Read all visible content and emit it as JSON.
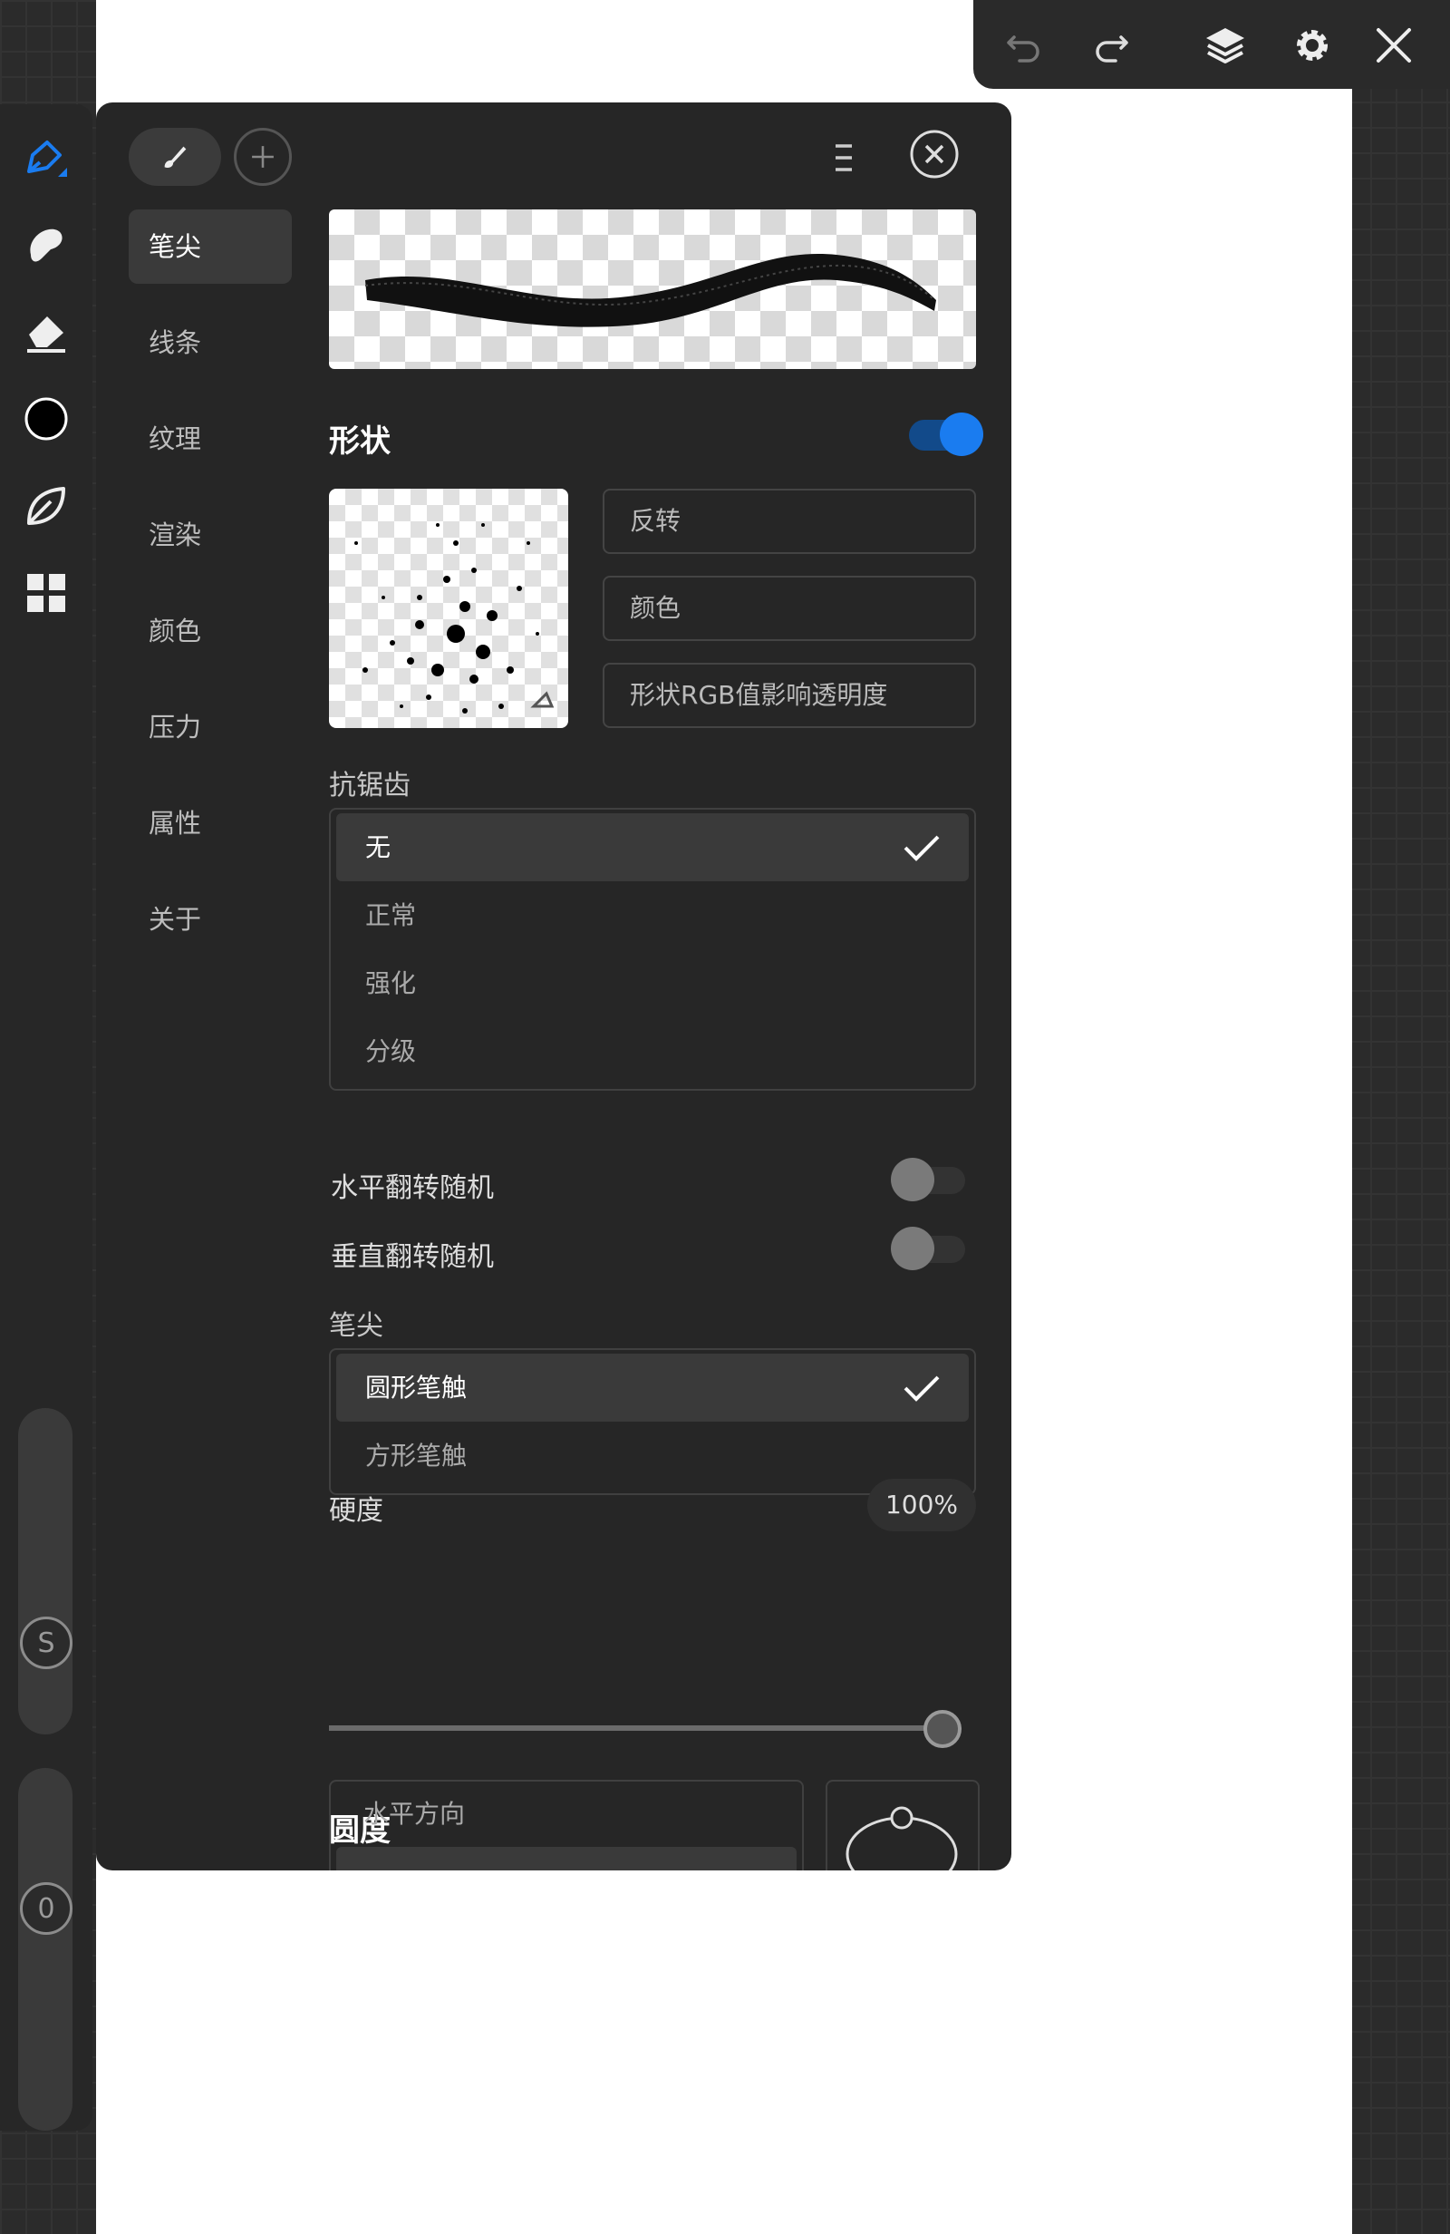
{
  "top_toolbar": {
    "icons": [
      "undo-icon",
      "redo-icon",
      "layers-icon",
      "settings-icon",
      "close-icon"
    ]
  },
  "left_toolbar": {
    "tools": [
      "brush-icon",
      "smudge-icon",
      "eraser-icon",
      "color-icon",
      "leaf-icon",
      "grid-icon"
    ],
    "size_slider_label": "S",
    "opacity_slider_label": "0"
  },
  "panel": {
    "nav": [
      "笔尖",
      "线条",
      "纹理",
      "渲染",
      "颜色",
      "压力",
      "属性",
      "关于"
    ],
    "active_nav_index": 0,
    "shape_title": "形状",
    "shape_toggle": "on",
    "shape_options": [
      "反转",
      "颜色",
      "形状RGB值影响透明度"
    ],
    "antialias_label": "抗锯齿",
    "antialias_options": [
      "无",
      "正常",
      "强化",
      "分级"
    ],
    "antialias_selected": 0,
    "flip_h_label": "水平翻转随机",
    "flip_v_label": "垂直翻转随机",
    "tip_label": "笔尖",
    "tip_options": [
      "圆形笔触",
      "方形笔触"
    ],
    "tip_selected": 0,
    "hardness_label": "硬度",
    "hardness_value": "100%",
    "hardness_fraction": 1.0,
    "roundness_title": "圆度",
    "roundness_direction": "水平方向"
  },
  "colors": {
    "accent": "#1a7cf0",
    "panel_bg": "#262626",
    "canvas": "#ffffff"
  }
}
